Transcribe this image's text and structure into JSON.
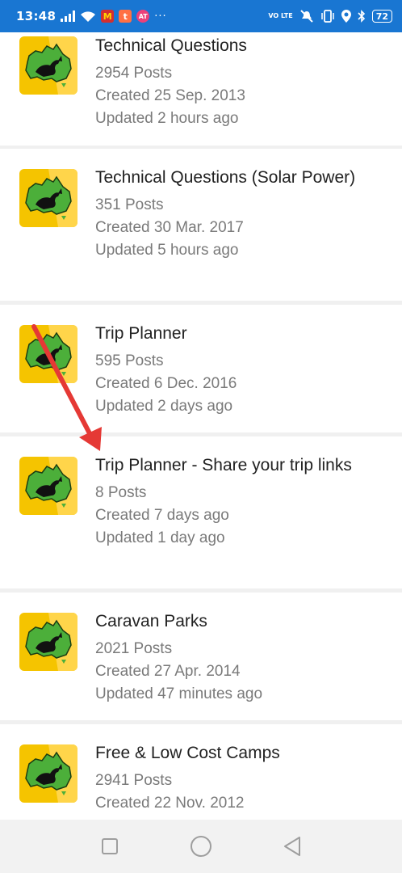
{
  "status_bar": {
    "time": "13:48",
    "notif_icons": [
      "M",
      "t",
      "AT"
    ],
    "more": "···",
    "volte": "VO LTE",
    "battery": "72"
  },
  "forums": [
    {
      "title": "Technical Questions",
      "posts": "2954 Posts",
      "created": "Created 25 Sep. 2013",
      "updated": "Updated 2 hours ago"
    },
    {
      "title": "Technical Questions (Solar Power)",
      "posts": "351 Posts",
      "created": "Created 30 Mar. 2017",
      "updated": "Updated 5 hours ago"
    },
    {
      "title": "Trip Planner",
      "posts": "595 Posts",
      "created": "Created 6 Dec. 2016",
      "updated": "Updated 2 days ago"
    },
    {
      "title": "Trip Planner - Share your trip links",
      "posts": "8 Posts",
      "created": "Created 7 days ago",
      "updated": "Updated 1 day ago"
    },
    {
      "title": "Caravan Parks",
      "posts": "2021 Posts",
      "created": "Created 27 Apr. 2014",
      "updated": "Updated 47 minutes ago"
    },
    {
      "title": "Free & Low Cost Camps",
      "posts": "2941 Posts",
      "created": "Created 22 Nov. 2012",
      "updated": ""
    }
  ],
  "colors": {
    "status_bar": "#1976d2",
    "logo_yellow": "#f5c400",
    "logo_green": "#4caf3a",
    "arrow": "#e53935"
  },
  "icons": {
    "forum_logo": "australia-kangaroo-logo-icon",
    "nav_recents": "square-icon",
    "nav_home": "circle-icon",
    "nav_back": "triangle-back-icon"
  }
}
